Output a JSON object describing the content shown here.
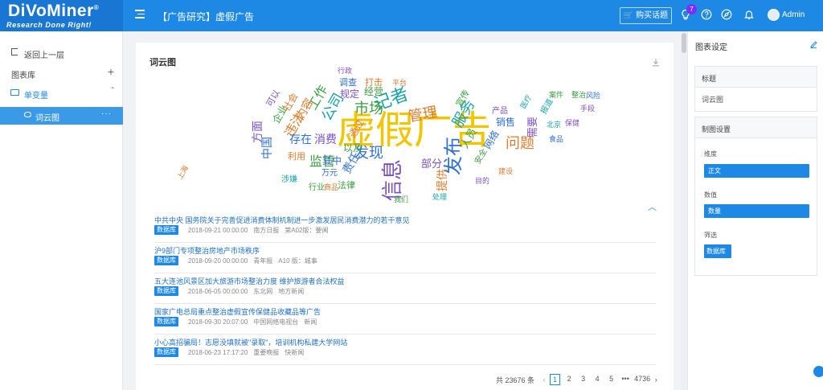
{
  "header": {
    "logo_main": "DiVoMiner",
    "logo_reg": "®",
    "logo_sub": "Research Done Right!",
    "page_title": "【广告研究】虚假广告",
    "buy_button": "购买话题",
    "notification_badge": "7",
    "user_name": "Admin"
  },
  "sidebar": {
    "back": "返回上一层",
    "chart_library": "图表库",
    "single_variable": "单变量",
    "wordcloud_item": "词云图",
    "more": "···"
  },
  "main": {
    "card_title": "词云图",
    "wordcloud": {
      "words": [
        {
          "t": "虚假广告",
          "c": "#f2c500"
        },
        {
          "t": "信息",
          "c": "#7b4fc9"
        },
        {
          "t": "发布",
          "c": "#2f6fd6"
        },
        {
          "t": "记者",
          "c": "#1aa1a7"
        },
        {
          "t": "市场",
          "c": "#3b9e3f"
        },
        {
          "t": "管理",
          "c": "#e07a2e"
        },
        {
          "t": "服务",
          "c": "#1aa1a7"
        },
        {
          "t": "发现",
          "c": "#2f6fd6"
        },
        {
          "t": "问题",
          "c": "#e07a2e"
        },
        {
          "t": "监管",
          "c": "#3b9e3f"
        },
        {
          "t": "违法",
          "c": "#e07a2e"
        },
        {
          "t": "消费",
          "c": "#7b4fc9"
        },
        {
          "t": "存在",
          "c": "#2f6fd6"
        },
        {
          "t": "公司",
          "c": "#1aa1a7"
        },
        {
          "t": "工作",
          "c": "#3b9e3f"
        },
        {
          "t": "内容",
          "c": "#e07a2e"
        },
        {
          "t": "中国",
          "c": "#2f6fd6"
        },
        {
          "t": "方面",
          "c": "#7b4fc9"
        },
        {
          "t": "人员",
          "c": "#3b9e3f"
        },
        {
          "t": "提供",
          "c": "#e07a2e"
        },
        {
          "t": "需要",
          "c": "#7b4fc9"
        },
        {
          "t": "以及",
          "c": "#3b9e3f"
        },
        {
          "t": "其中",
          "c": "#2f6fd6"
        },
        {
          "t": "法律",
          "c": "#3b9e3f"
        },
        {
          "t": "利用",
          "c": "#e07a2e"
        },
        {
          "t": "涉嫌",
          "c": "#1aa1a7"
        },
        {
          "t": "规定",
          "c": "#7b4fc9"
        },
        {
          "t": "经营",
          "c": "#3b9e3f"
        },
        {
          "t": "调查",
          "c": "#2f6fd6"
        },
        {
          "t": "打击",
          "c": "#e07a2e"
        },
        {
          "t": "行政",
          "c": "#7b4fc9"
        },
        {
          "t": "通过",
          "c": "#e07a2e"
        },
        {
          "t": "责任",
          "c": "#2f6fd6"
        },
        {
          "t": "宣传",
          "c": "#3b9e3f"
        },
        {
          "t": "部分",
          "c": "#7b4fc9"
        },
        {
          "t": "网络",
          "c": "#2f6fd6"
        },
        {
          "t": "企业",
          "c": "#3b9e3f"
        },
        {
          "t": "社会",
          "c": "#e07a2e"
        },
        {
          "t": "可以",
          "c": "#7b4fc9"
        },
        {
          "t": "万元",
          "c": "#2f6fd6"
        },
        {
          "t": "行业",
          "c": "#3b9e3f"
        },
        {
          "t": "报道",
          "c": "#1aa1a7"
        },
        {
          "t": "商品",
          "c": "#e07a2e"
        },
        {
          "t": "销售",
          "c": "#2f6fd6"
        },
        {
          "t": "产品",
          "c": "#7b4fc9"
        },
        {
          "t": "安全",
          "c": "#3b9e3f"
        },
        {
          "t": "医疗",
          "c": "#1aa1a7"
        },
        {
          "t": "平台",
          "c": "#e07a2e"
        },
        {
          "t": "手段",
          "c": "#7b4fc9"
        },
        {
          "t": "整治",
          "c": "#3b9e3f"
        },
        {
          "t": "风险",
          "c": "#2f6fd6"
        },
        {
          "t": "上海",
          "c": "#e07a2e"
        },
        {
          "t": "北京",
          "c": "#1aa1a7"
        },
        {
          "t": "案件",
          "c": "#3b9e3f"
        },
        {
          "t": "保健",
          "c": "#7b4fc9"
        },
        {
          "t": "食品",
          "c": "#2f6fd6"
        },
        {
          "t": "我们",
          "c": "#3b9e3f"
        },
        {
          "t": "处理",
          "c": "#1aa1a7"
        },
        {
          "t": "目的",
          "c": "#7b4fc9"
        },
        {
          "t": "建设",
          "c": "#e07a2e"
        }
      ]
    },
    "news": [
      {
        "title": "中共中央 国务院关于完善促进消费体制机制进一步激发居民消费潜力的若干意见",
        "tag": "数据库",
        "meta": [
          "2018-09-21 00:00:00",
          "南方日报",
          "第A02版：要闻"
        ]
      },
      {
        "title": "沪9部门专项整治房地产市场秩序",
        "tag": "数据库",
        "meta": [
          "2018-09-20 00:00:00",
          "青年报",
          "A10 版：城事"
        ]
      },
      {
        "title": "五大连池风景区加大旅游市场整治力度 维护旅游者合法权益",
        "tag": "数据库",
        "meta": [
          "2018-06-05 00:00:00",
          "东北网",
          "地方新闻"
        ]
      },
      {
        "title": "国家广电总局重点整治虚假宣传保健品收藏品等广告",
        "tag": "数据库",
        "meta": [
          "2018-09-30 20:07:00",
          "中国网络电视台",
          "新闻"
        ]
      },
      {
        "title": "小心高招骗局！志愿没填就被\"录取\"，培训机构私建大学网站",
        "tag": "数据库",
        "meta": [
          "2018-06-23 17:17:20",
          "重要晚报",
          "快新闻"
        ]
      }
    ],
    "pagination": {
      "total": "共 23676 条",
      "pages": [
        "1",
        "2",
        "3",
        "4",
        "5"
      ],
      "ellipsis": "•••",
      "last": "4736",
      "current": "1"
    }
  },
  "right_panel": {
    "title": "图表设定",
    "title_section": "标题",
    "title_value": "词云图",
    "settings_section": "制图设置",
    "dimension_label": "维度",
    "dimension_value": "正文",
    "value_label": "数值",
    "value_value": "数量",
    "filter_label": "筛选",
    "filter_value": "数据库"
  },
  "colors": {
    "primary": "#1e88e5",
    "header_dark": "#1976d2",
    "link": "#1e6fc7",
    "badge": "#7b2ff7"
  }
}
